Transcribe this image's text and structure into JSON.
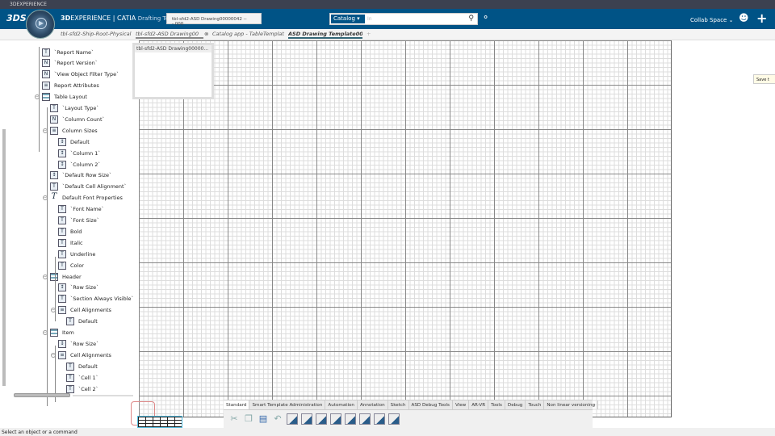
{
  "window": {
    "title": "3DEXPERIENCE"
  },
  "topbar": {
    "brand_logo": "3DS",
    "app_title_bold": "3D",
    "app_title_rest": "EXPERIENCE | CATIA",
    "app_subtitle": "Drafting Ter",
    "tooltip": "tbl-sfd2-ASD Drawing00000042 ---.000",
    "search_scope": "Catalog",
    "search_placeholder": "In",
    "collab_space": "Collab Space",
    "compass_icon": "play-compass"
  },
  "tabs": [
    {
      "label": "tbl-sfd2-Ship-Root-Physical"
    },
    {
      "label": "tbl-sfd2-ASD Drawing00"
    },
    {
      "label": "Catalog app - TableTemplat"
    },
    {
      "label": "ASD Drawing Template000",
      "active": true
    }
  ],
  "tab_add": "+",
  "preview": {
    "title": "tbl-sfd2-ASD Drawing00000..."
  },
  "save_tip": "Save t",
  "tree": [
    {
      "label": "`Report Name`",
      "level": 0,
      "icon": "T"
    },
    {
      "label": "`Report Version`",
      "level": 0,
      "icon": "N"
    },
    {
      "label": "`View Object Filter Type`",
      "level": 0,
      "icon": "N"
    },
    {
      "label": "Report Attributes",
      "level": 0,
      "icon": "list"
    },
    {
      "label": "Table Layout",
      "level": 0,
      "icon": "table",
      "expanded": true
    },
    {
      "label": "`Layout Type`",
      "level": 1,
      "icon": "T"
    },
    {
      "label": "`Column Count`",
      "level": 1,
      "icon": "N"
    },
    {
      "label": "Column Sizes",
      "level": 1,
      "icon": "list",
      "expanded": true
    },
    {
      "label": "Default",
      "level": 2,
      "icon": "size"
    },
    {
      "label": "`Column 1`",
      "level": 2,
      "icon": "size"
    },
    {
      "label": "`Column 2`",
      "level": 2,
      "icon": "size"
    },
    {
      "label": "`Default Row Size`",
      "level": 1,
      "icon": "size"
    },
    {
      "label": "`Default Cell Alignment`",
      "level": 1,
      "icon": "T"
    },
    {
      "label": "Default Font Properties",
      "level": 1,
      "icon": "font",
      "expanded": true
    },
    {
      "label": "`Font Name`",
      "level": 2,
      "icon": "T"
    },
    {
      "label": "`Font Size`",
      "level": 2,
      "icon": "T"
    },
    {
      "label": "Bold",
      "level": 2,
      "icon": "T"
    },
    {
      "label": "Italic",
      "level": 2,
      "icon": "T"
    },
    {
      "label": "Underline",
      "level": 2,
      "icon": "T"
    },
    {
      "label": "Color",
      "level": 2,
      "icon": "T"
    },
    {
      "label": "Header",
      "level": 1,
      "icon": "table",
      "expanded": true
    },
    {
      "label": "`Row Size`",
      "level": 2,
      "icon": "size"
    },
    {
      "label": "`Section Always Visible`",
      "level": 2,
      "icon": "T"
    },
    {
      "label": "Cell Alignments",
      "level": 2,
      "icon": "list",
      "expanded": true
    },
    {
      "label": "Default",
      "level": 3,
      "icon": "T"
    },
    {
      "label": "Item",
      "level": 1,
      "icon": "table",
      "expanded": true
    },
    {
      "label": "`Row Size`",
      "level": 2,
      "icon": "size"
    },
    {
      "label": "Cell Alignments",
      "level": 2,
      "icon": "list",
      "expanded": true
    },
    {
      "label": "Default",
      "level": 3,
      "icon": "T"
    },
    {
      "label": "`Cell 1`",
      "level": 3,
      "icon": "T"
    },
    {
      "label": "`Cell 2`",
      "level": 3,
      "icon": "T"
    }
  ],
  "action_bar": {
    "tabs": [
      "Standard",
      "Smart Template Administration",
      "Automation",
      "Annotation",
      "Sketch",
      "ASD Debug Tools",
      "View",
      "AR-VR",
      "Tools",
      "Debug",
      "Touch",
      "Non linear versioning"
    ],
    "selected": "Standard"
  },
  "status_bar": "Select an object or a command"
}
